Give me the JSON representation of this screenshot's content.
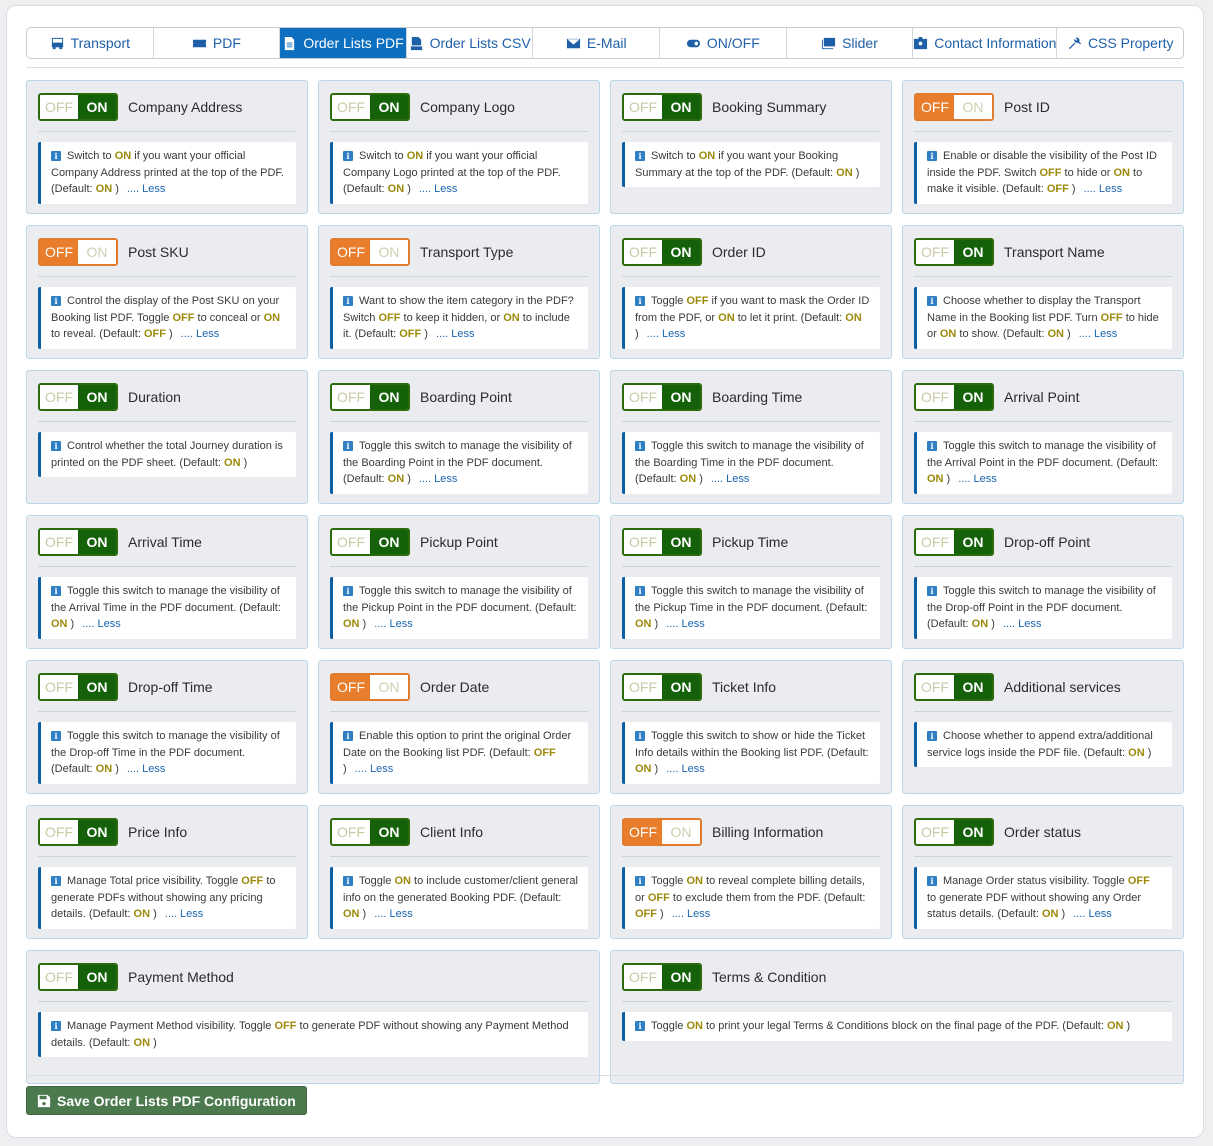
{
  "tabs": [
    {
      "label": "Transport",
      "icon": "bus-icon",
      "active": false
    },
    {
      "label": "PDF",
      "icon": "ticket-icon",
      "active": false
    },
    {
      "label": "Order Lists PDF",
      "icon": "document-icon",
      "active": true
    },
    {
      "label": "Order Lists CSV",
      "icon": "csv-file-icon",
      "active": false
    },
    {
      "label": "E-Mail",
      "icon": "envelope-icon",
      "active": false
    },
    {
      "label": "ON/OFF",
      "icon": "toggle-icon",
      "active": false
    },
    {
      "label": "Slider",
      "icon": "images-icon",
      "active": false
    },
    {
      "label": "Contact Information",
      "icon": "id-badge-icon",
      "active": false
    },
    {
      "label": "CSS Property",
      "icon": "tools-icon",
      "active": false
    }
  ],
  "switch_labels": {
    "off": "OFF",
    "on": "ON"
  },
  "less_label": ".... Less",
  "settings": [
    {
      "title": "Company Address",
      "state": "on",
      "desc": [
        [
          "Switch to ",
          ""
        ],
        [
          "ON",
          "k"
        ],
        [
          " if you want your official Company Address printed at the top of the PDF. (Default: ",
          ""
        ],
        [
          "ON",
          "k"
        ],
        [
          " )",
          ""
        ]
      ],
      "less": true
    },
    {
      "title": "Company Logo",
      "state": "on",
      "desc": [
        [
          "Switch to ",
          ""
        ],
        [
          "ON",
          "k"
        ],
        [
          " if you want your official Company Logo printed at the top of the PDF. (Default: ",
          ""
        ],
        [
          "ON",
          "k"
        ],
        [
          " )",
          ""
        ]
      ],
      "less": true
    },
    {
      "title": "Booking Summary",
      "state": "on",
      "desc": [
        [
          "Switch to ",
          ""
        ],
        [
          "ON",
          "k"
        ],
        [
          " if you want your Booking Summary at the top of the PDF. (Default: ",
          ""
        ],
        [
          "ON",
          "k"
        ],
        [
          " )",
          ""
        ]
      ],
      "less": false
    },
    {
      "title": "Post ID",
      "state": "off",
      "desc": [
        [
          "Enable or disable the visibility of the Post ID inside the PDF. Switch ",
          ""
        ],
        [
          "OFF",
          "k"
        ],
        [
          " to hide or ",
          ""
        ],
        [
          "ON",
          "k"
        ],
        [
          " to make it visible. (Default: ",
          ""
        ],
        [
          "OFF",
          "k"
        ],
        [
          " )",
          ""
        ]
      ],
      "less": true
    },
    {
      "title": "Post SKU",
      "state": "off",
      "desc": [
        [
          "Control the display of the Post SKU on your Booking list PDF. Toggle ",
          ""
        ],
        [
          "OFF",
          "k"
        ],
        [
          " to conceal or ",
          ""
        ],
        [
          "ON",
          "k"
        ],
        [
          " to reveal. (Default: ",
          ""
        ],
        [
          "OFF",
          "k"
        ],
        [
          " )",
          ""
        ]
      ],
      "less": true
    },
    {
      "title": "Transport Type",
      "state": "off",
      "desc": [
        [
          "Want to show the item category in the PDF? Switch ",
          ""
        ],
        [
          "OFF",
          "k"
        ],
        [
          " to keep it hidden, or ",
          ""
        ],
        [
          "ON",
          "k"
        ],
        [
          " to include it. (Default: ",
          ""
        ],
        [
          "OFF",
          "k"
        ],
        [
          " )",
          ""
        ]
      ],
      "less": true
    },
    {
      "title": "Order ID",
      "state": "on",
      "desc": [
        [
          "Toggle ",
          ""
        ],
        [
          "OFF",
          "k"
        ],
        [
          " if you want to mask the Order ID from the PDF, or ",
          ""
        ],
        [
          "ON",
          "k"
        ],
        [
          " to let it print. (Default: ",
          ""
        ],
        [
          "ON",
          "k"
        ],
        [
          " )",
          ""
        ]
      ],
      "less": true
    },
    {
      "title": "Transport Name",
      "state": "on",
      "desc": [
        [
          "Choose whether to display the Transport Name in the Booking list PDF. Turn ",
          ""
        ],
        [
          "OFF",
          "k"
        ],
        [
          " to hide or ",
          ""
        ],
        [
          "ON",
          "k"
        ],
        [
          " to show. (Default: ",
          ""
        ],
        [
          "ON",
          "k"
        ],
        [
          " )",
          ""
        ]
      ],
      "less": true
    },
    {
      "title": "Duration",
      "state": "on",
      "desc": [
        [
          "Control whether the total Journey duration is printed on the PDF sheet. (Default: ",
          ""
        ],
        [
          "ON",
          "k"
        ],
        [
          " )",
          ""
        ]
      ],
      "less": false
    },
    {
      "title": "Boarding Point",
      "state": "on",
      "desc": [
        [
          "Toggle this switch to manage the visibility of the Boarding Point in the PDF document. (Default: ",
          ""
        ],
        [
          "ON",
          "k"
        ],
        [
          " )",
          ""
        ]
      ],
      "less": true
    },
    {
      "title": "Boarding Time",
      "state": "on",
      "desc": [
        [
          "Toggle this switch to manage the visibility of the Boarding Time in the PDF document. (Default: ",
          ""
        ],
        [
          "ON",
          "k"
        ],
        [
          " )",
          ""
        ]
      ],
      "less": true
    },
    {
      "title": "Arrival Point",
      "state": "on",
      "desc": [
        [
          "Toggle this switch to manage the visibility of the Arrival Point in the PDF document. (Default: ",
          ""
        ],
        [
          "ON",
          "k"
        ],
        [
          " )",
          ""
        ]
      ],
      "less": true
    },
    {
      "title": "Arrival Time",
      "state": "on",
      "desc": [
        [
          "Toggle this switch to manage the visibility of the Arrival Time in the PDF document. (Default: ",
          ""
        ],
        [
          "ON",
          "k"
        ],
        [
          " )",
          ""
        ]
      ],
      "less": true
    },
    {
      "title": "Pickup Point",
      "state": "on",
      "desc": [
        [
          "Toggle this switch to manage the visibility of the Pickup Point in the PDF document. (Default: ",
          ""
        ],
        [
          "ON",
          "k"
        ],
        [
          " )",
          ""
        ]
      ],
      "less": true
    },
    {
      "title": "Pickup Time",
      "state": "on",
      "desc": [
        [
          "Toggle this switch to manage the visibility of the Pickup Time in the PDF document. (Default: ",
          ""
        ],
        [
          "ON",
          "k"
        ],
        [
          " )",
          ""
        ]
      ],
      "less": true
    },
    {
      "title": "Drop-off Point",
      "state": "on",
      "desc": [
        [
          "Toggle this switch to manage the visibility of the Drop-off Point in the PDF document. (Default: ",
          ""
        ],
        [
          "ON",
          "k"
        ],
        [
          " )",
          ""
        ]
      ],
      "less": true
    },
    {
      "title": "Drop-off Time",
      "state": "on",
      "desc": [
        [
          "Toggle this switch to manage the visibility of the Drop-off Time in the PDF document. (Default: ",
          ""
        ],
        [
          "ON",
          "k"
        ],
        [
          " )",
          ""
        ]
      ],
      "less": true
    },
    {
      "title": "Order Date",
      "state": "off",
      "desc": [
        [
          "Enable this option to print the original Order Date on the Booking list PDF. (Default: ",
          ""
        ],
        [
          "OFF",
          "k"
        ],
        [
          " )",
          ""
        ]
      ],
      "less": true
    },
    {
      "title": "Ticket Info",
      "state": "on",
      "desc": [
        [
          "Toggle this switch to show or hide the Ticket Info details within the Booking list PDF. (Default: ",
          ""
        ],
        [
          "ON",
          "k"
        ],
        [
          " )",
          ""
        ]
      ],
      "less": true
    },
    {
      "title": "Additional services",
      "state": "on",
      "desc": [
        [
          "Choose whether to append extra/additional service logs inside the PDF file. (Default: ",
          ""
        ],
        [
          "ON",
          "k"
        ],
        [
          " )",
          ""
        ]
      ],
      "less": false
    },
    {
      "title": "Price Info",
      "state": "on",
      "desc": [
        [
          "Manage Total price visibility. Toggle ",
          ""
        ],
        [
          "OFF",
          "k"
        ],
        [
          " to generate PDFs without showing any pricing details. (Default: ",
          ""
        ],
        [
          "ON",
          "k"
        ],
        [
          " )",
          ""
        ]
      ],
      "less": true
    },
    {
      "title": "Client Info",
      "state": "on",
      "desc": [
        [
          "Toggle ",
          ""
        ],
        [
          "ON",
          "k"
        ],
        [
          " to include customer/client general info on the generated Booking PDF. (Default: ",
          ""
        ],
        [
          "ON",
          "k"
        ],
        [
          " )",
          ""
        ]
      ],
      "less": true
    },
    {
      "title": "Billing Information",
      "state": "off",
      "desc": [
        [
          "Toggle ",
          ""
        ],
        [
          "ON",
          "k"
        ],
        [
          " to reveal complete billing details, or ",
          ""
        ],
        [
          "OFF",
          "k"
        ],
        [
          " to exclude them from the PDF. (Default: ",
          ""
        ],
        [
          "OFF",
          "k"
        ],
        [
          " )",
          ""
        ]
      ],
      "less": true
    },
    {
      "title": "Order status",
      "state": "on",
      "desc": [
        [
          "Manage Order status visibility. Toggle ",
          ""
        ],
        [
          "OFF",
          "k"
        ],
        [
          " to generate PDF without showing any Order status details. (Default: ",
          ""
        ],
        [
          "ON",
          "k"
        ],
        [
          " )",
          ""
        ]
      ],
      "less": true
    },
    {
      "title": "Payment Method",
      "state": "on",
      "wide": true,
      "desc": [
        [
          "Manage Payment Method visibility. Toggle ",
          ""
        ],
        [
          "OFF",
          "k"
        ],
        [
          " to generate PDF without showing any Payment Method details. (Default: ",
          ""
        ],
        [
          "ON",
          "k"
        ],
        [
          " )",
          ""
        ]
      ],
      "less": false
    },
    {
      "title": "Terms & Condition",
      "state": "on",
      "wide": true,
      "desc": [
        [
          "Toggle ",
          ""
        ],
        [
          "ON",
          "k"
        ],
        [
          " to print your legal Terms & Conditions block on the final page of the PDF. (Default: ",
          ""
        ],
        [
          "ON",
          "k"
        ],
        [
          " )",
          ""
        ]
      ],
      "less": false
    }
  ],
  "save_button": {
    "label": "Save Order Lists PDF Configuration",
    "icon": "floppy-disk-icon"
  },
  "colors": {
    "accent": "#0d6fbf",
    "on": "#14610a",
    "off": "#e87d2b",
    "keyword": "#9c8a0a",
    "save": "#4c7a4e"
  }
}
